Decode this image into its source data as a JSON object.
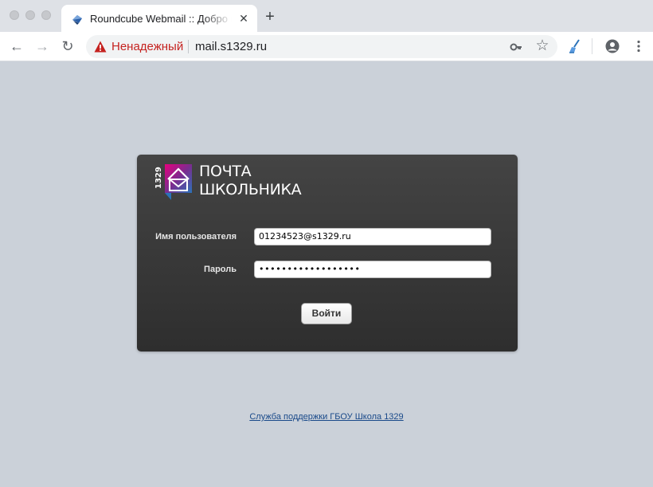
{
  "browser": {
    "tab": {
      "title": "Roundcube Webmail :: Добро пожаловать в Roundcube Webmail",
      "close": "✕"
    },
    "new_tab": "+",
    "nav": {
      "back": "←",
      "forward": "→",
      "reload": "↻"
    },
    "address": {
      "security_label": "Ненадежный",
      "url": "mail.s1329.ru"
    },
    "bookmark_star": "☆",
    "icons": [
      "browser-favicon",
      "warning-icon",
      "key-icon",
      "star-icon",
      "extension-broom-icon",
      "profile-icon",
      "menu-dots-icon"
    ]
  },
  "login": {
    "logo": {
      "badge": "1329",
      "line1": "ПОЧТА",
      "line2": "ШКОЛЬНИКА",
      "colors": [
        "#e6007e",
        "#7b2c8f",
        "#2b73b9"
      ]
    },
    "username": {
      "label": "Имя пользователя",
      "value": "01234523@s1329.ru"
    },
    "password": {
      "label": "Пароль",
      "value": "••••••••••••••••••"
    },
    "submit_label": "Войти"
  },
  "footer": {
    "support_link": "Служба поддержки ГБОУ Школа 1329"
  },
  "colors": {
    "page_bg": "#cbd1d9",
    "panel_bg": "#3a3a3a",
    "warning": "#c5221f",
    "link": "#1a4a8a"
  }
}
